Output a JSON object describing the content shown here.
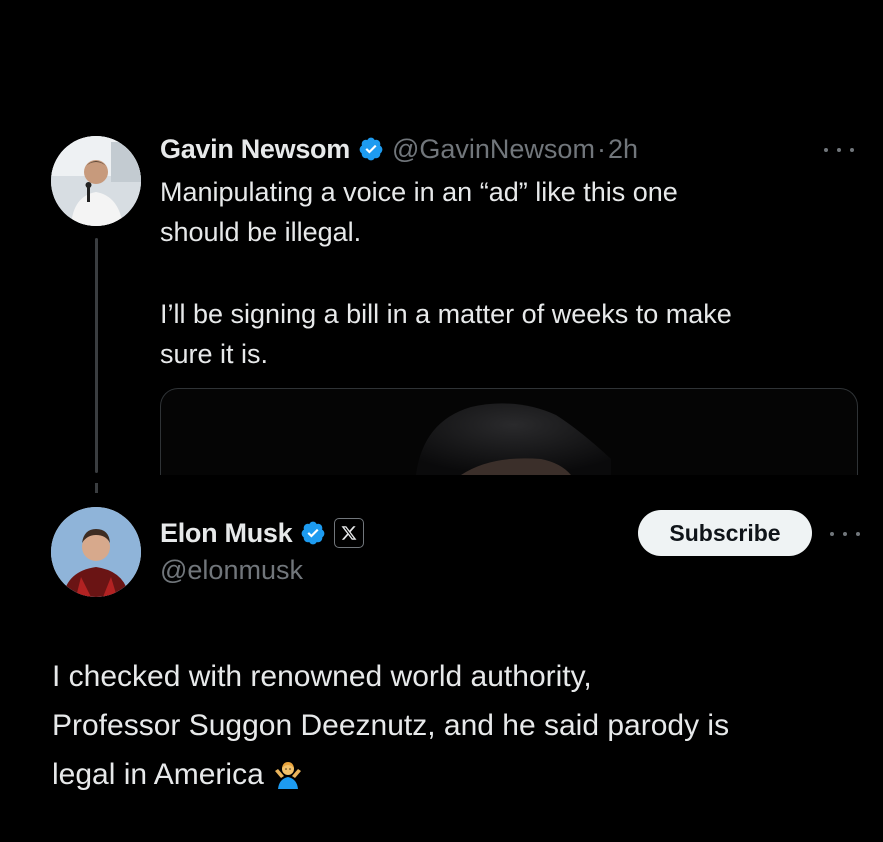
{
  "tweet": {
    "author_name": "Gavin Newsom",
    "author_handle": "@GavinNewsom",
    "separator": "·",
    "time": "2h",
    "text_lines": [
      "Manipulating a voice in an “ad” like this one",
      "should be illegal.",
      "I’ll be signing a bill in a matter of weeks to make",
      "sure it is."
    ],
    "verified_icon": "verified-badge-icon",
    "more_icon": "more-options-icon"
  },
  "reply": {
    "author_name": "Elon Musk",
    "author_handle": "@elonmusk",
    "affiliate_badge_icon": "x-logo-icon",
    "subscribe_label": "Subscribe",
    "text_lines": [
      "I checked with renowned world authority,",
      "Professor Suggon Deeznutz, and he said parody is",
      "legal in America"
    ],
    "emoji_icon": "person-shrugging-emoji",
    "more_icon": "more-options-icon"
  },
  "colors": {
    "background": "#000000",
    "text_primary": "#e7e9ea",
    "text_secondary": "#71767b",
    "verified_blue": "#1d9bf0",
    "button_bg": "#eff3f4",
    "button_text": "#0f1419"
  }
}
